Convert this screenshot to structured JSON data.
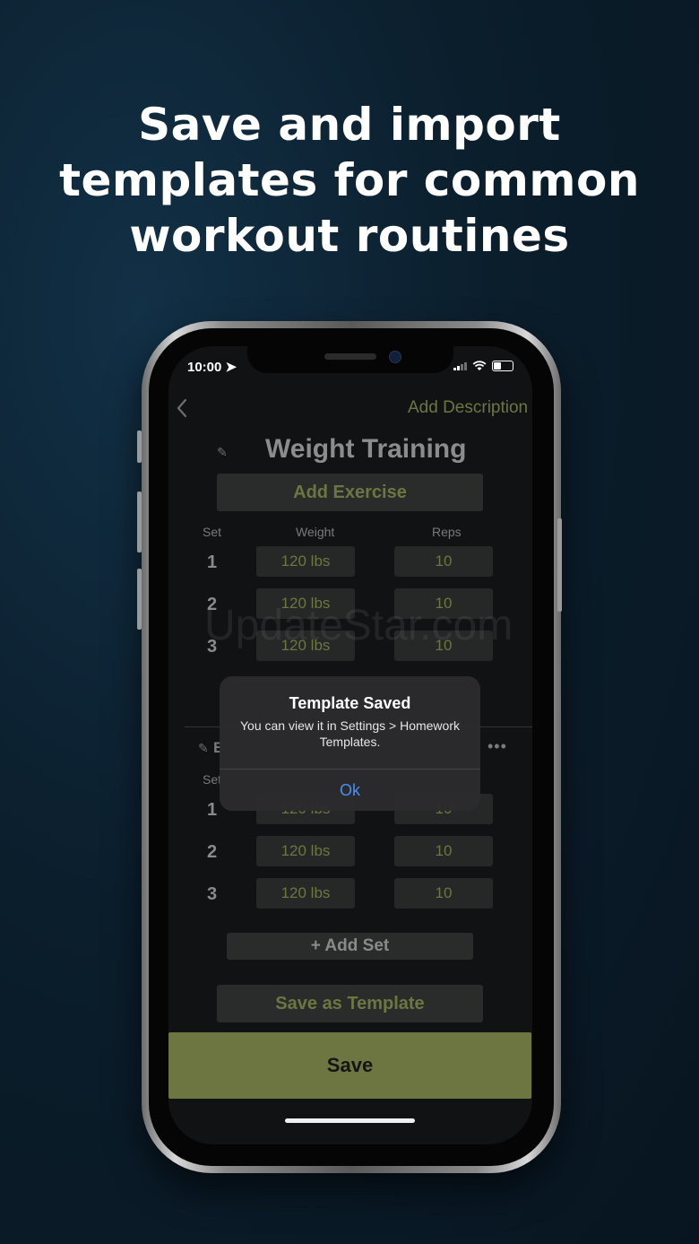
{
  "headline": {
    "line1": "Save and import",
    "line2": "templates for common",
    "line3": "workout routines"
  },
  "status_bar": {
    "time": "10:00 ➤"
  },
  "header": {
    "back_icon": "chevron-left-icon",
    "add_description": "Add Description"
  },
  "workout": {
    "title": "Weight Training",
    "add_exercise": "Add Exercise"
  },
  "exercise1": {
    "col_set": "Set",
    "col_weight": "Weight",
    "col_reps": "Reps",
    "sets": [
      {
        "num": "1",
        "weight": "120 lbs",
        "reps": "10"
      },
      {
        "num": "2",
        "weight": "120 lbs",
        "reps": "10"
      },
      {
        "num": "3",
        "weight": "120 lbs",
        "reps": "10"
      }
    ]
  },
  "exercise2": {
    "partial_title": "E",
    "col_set": "Set",
    "more": "•••",
    "sets": [
      {
        "num": "1",
        "weight": "120 lbs",
        "reps": "10"
      },
      {
        "num": "2",
        "weight": "120 lbs",
        "reps": "10"
      },
      {
        "num": "3",
        "weight": "120 lbs",
        "reps": "10"
      }
    ],
    "add_set": "+ Add Set"
  },
  "save_as_template": "Save as Template",
  "save": "Save",
  "watermark": "UpdateStar.com",
  "alert": {
    "title": "Template Saved",
    "message": "You can view it in Settings > Homework Templates.",
    "ok": "Ok"
  },
  "colors": {
    "accent": "#6d7640",
    "alert_link": "#4a8ff0"
  }
}
